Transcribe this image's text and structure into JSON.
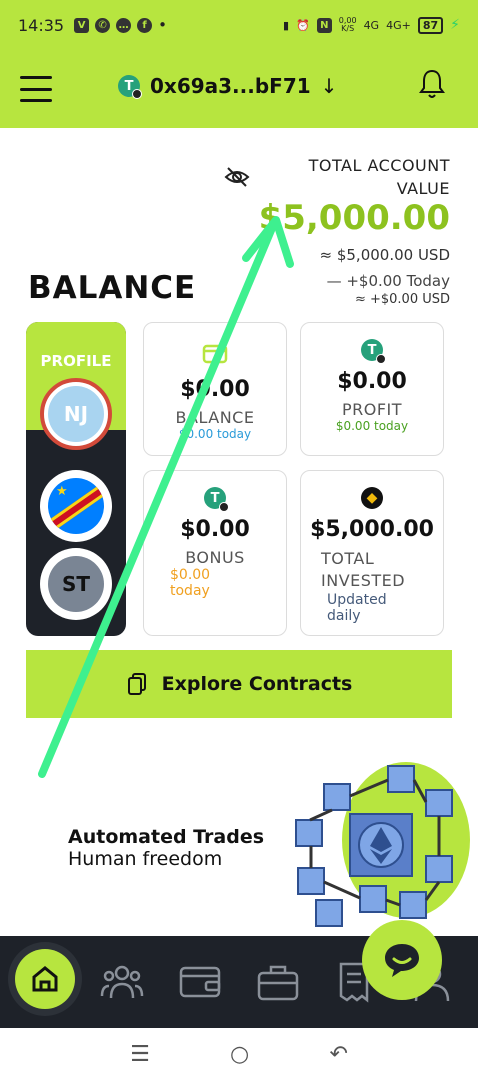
{
  "status_bar": {
    "time": "14:35",
    "speed_top": "0,00",
    "speed_unit": "K/S",
    "net1": "4G",
    "net2": "4G+",
    "battery": "87"
  },
  "header": {
    "wallet_address": "0x69a3...bF71",
    "wallet_arrow": "↓",
    "token_symbol": "T"
  },
  "account": {
    "total_label": "TOTAL ACCOUNT VALUE",
    "total_value": "$5,000.00",
    "usd_value": "≈ $5,000.00 USD",
    "today_change": "— +$0.00 Today",
    "today_usd": "≈ +$0.00 USD"
  },
  "balance_title": "BALANCE",
  "profile": {
    "label": "PROFILE",
    "avatars": [
      "NJ",
      "",
      "ST"
    ]
  },
  "cards": [
    {
      "amount": "$0.00",
      "name": "BALANCE",
      "sub": "$0.00 today",
      "icon": "wallet-card-icon",
      "sub_color": "#2a9bd8"
    },
    {
      "amount": "$0.00",
      "name": "PROFIT",
      "sub": "$0.00 today",
      "icon": "tether-icon",
      "sub_color": "#4aa121"
    },
    {
      "amount": "$0.00",
      "name": "BONUS",
      "sub": "$0.00 today",
      "icon": "tether-icon",
      "sub_color": "#f0a020"
    },
    {
      "amount": "$5,000.00",
      "name": "TOTAL INVESTED",
      "sub": "Updated daily",
      "icon": "bnb-icon",
      "sub_color": "#455a7a"
    }
  ],
  "explore_button": "Explore Contracts",
  "promo": {
    "line1": "Automated Trades",
    "line2": "Human freedom"
  },
  "colors": {
    "brand_green": "#b7e53f",
    "value_green": "#8dc21f",
    "nav_dark": "#1e2229",
    "annotation_arrow": "#3ef08f"
  },
  "bottom_nav": [
    "home-icon",
    "team-icon",
    "wallet-icon",
    "briefcase-icon",
    "receipt-icon",
    "profile-icon"
  ]
}
